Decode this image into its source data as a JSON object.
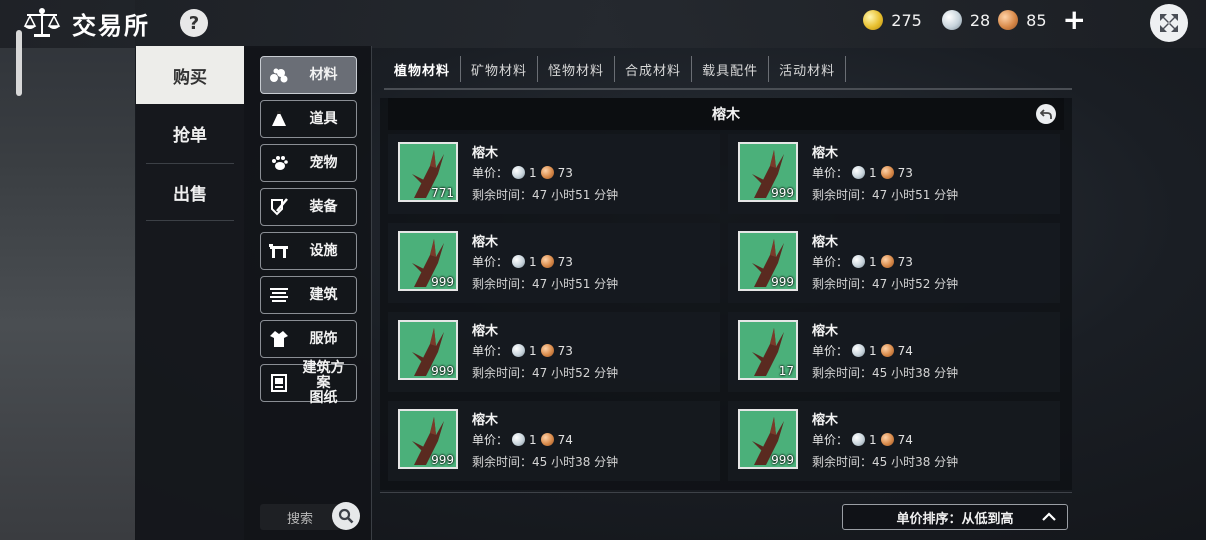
{
  "header": {
    "title": "交易所",
    "help_label": "?",
    "currency": {
      "gold": "275",
      "silver": "28",
      "copper": "85"
    }
  },
  "modes": [
    "购买",
    "抢单",
    "出售"
  ],
  "categories": [
    {
      "label": "材料",
      "icon": "materials-icon"
    },
    {
      "label": "道具",
      "icon": "prop-icon"
    },
    {
      "label": "宠物",
      "icon": "paw-icon"
    },
    {
      "label": "装备",
      "icon": "equipment-icon"
    },
    {
      "label": "设施",
      "icon": "facility-icon"
    },
    {
      "label": "建筑",
      "icon": "building-icon"
    },
    {
      "label": "服饰",
      "icon": "clothing-icon"
    },
    {
      "label": "建筑方案\n图纸",
      "label_line1": "建筑方案",
      "label_line2": "图纸",
      "icon": "blueprint-icon"
    }
  ],
  "search": {
    "placeholder": "搜索"
  },
  "tabs": [
    "植物材料",
    "矿物材料",
    "怪物材料",
    "合成材料",
    "载具配件",
    "活动材料"
  ],
  "list": {
    "header": "榕木",
    "price_label": "单价：",
    "time_label": "剩余时间：",
    "items": [
      {
        "name": "榕木",
        "qty": "771",
        "silver": "1",
        "copper": "73",
        "time": "47 小时51 分钟"
      },
      {
        "name": "榕木",
        "qty": "999",
        "silver": "1",
        "copper": "73",
        "time": "47 小时51 分钟"
      },
      {
        "name": "榕木",
        "qty": "999",
        "silver": "1",
        "copper": "73",
        "time": "47 小时51 分钟"
      },
      {
        "name": "榕木",
        "qty": "999",
        "silver": "1",
        "copper": "73",
        "time": "47 小时52 分钟"
      },
      {
        "name": "榕木",
        "qty": "999",
        "silver": "1",
        "copper": "73",
        "time": "47 小时52 分钟"
      },
      {
        "name": "榕木",
        "qty": "17",
        "silver": "1",
        "copper": "74",
        "time": "45 小时38 分钟"
      },
      {
        "name": "榕木",
        "qty": "999",
        "silver": "1",
        "copper": "74",
        "time": "45 小时38 分钟"
      },
      {
        "name": "榕木",
        "qty": "999",
        "silver": "1",
        "copper": "74",
        "time": "45 小时38 分钟"
      }
    ]
  },
  "sort": {
    "label": "单价排序：从低到高"
  },
  "colors": {
    "thumb_bg": "#4bb07a",
    "active_mode_bg": "#ededea"
  }
}
